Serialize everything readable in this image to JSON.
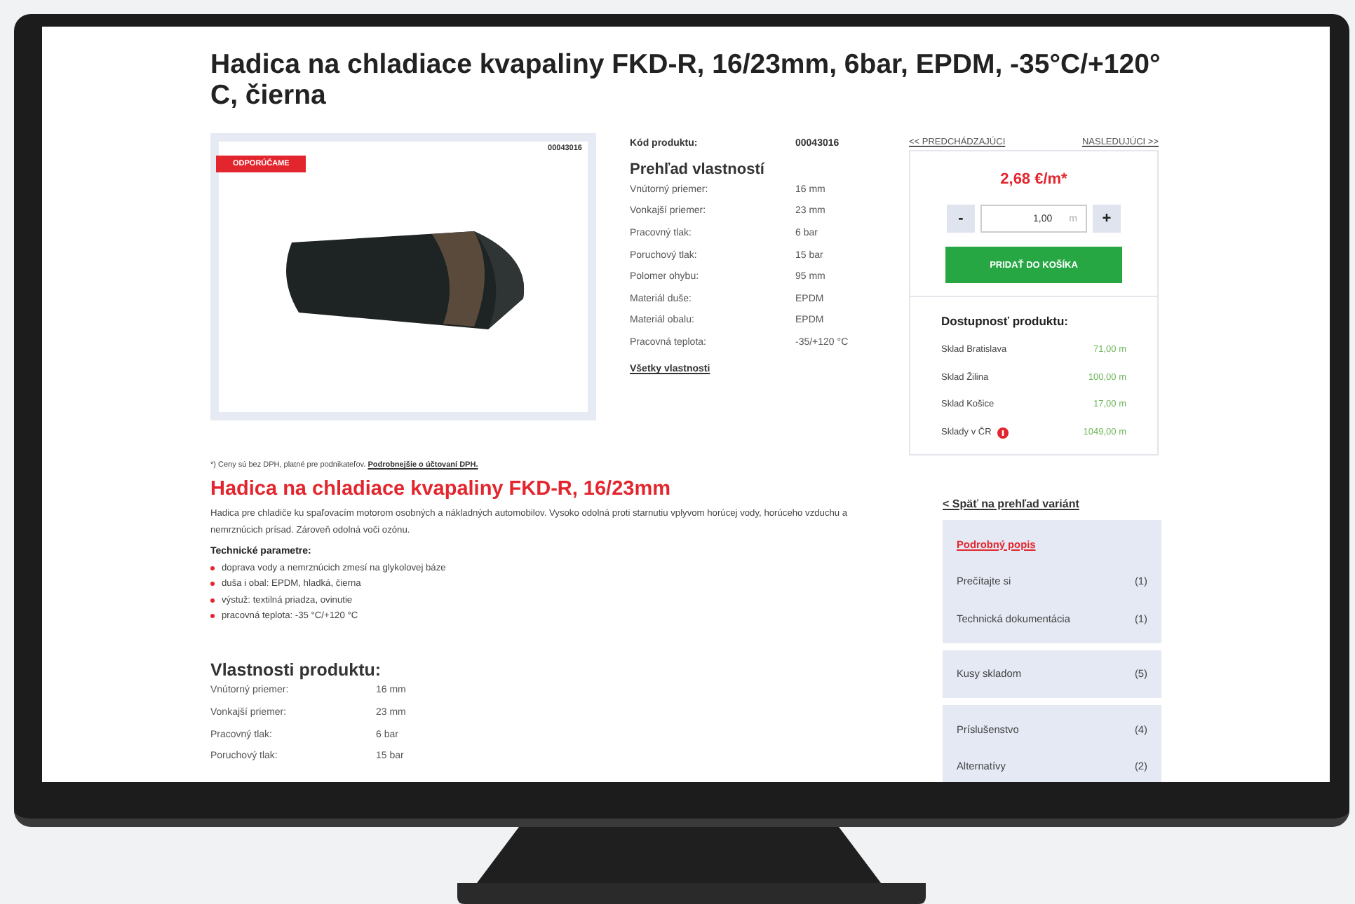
{
  "title": "Hadica na chladiace kvapaliny FKD-R, 16/23mm, 6bar, EPDM, -35°C/+120° C, čierna",
  "product_image": {
    "badge": "ODPORÚČAME",
    "code": "00043016"
  },
  "overview": {
    "code_label": "Kód produktu:",
    "code_value": "00043016",
    "heading": "Prehľad vlastností",
    "rows": [
      {
        "label": "Vnútorný priemer:",
        "value": "16 mm"
      },
      {
        "label": "Vonkajší priemer:",
        "value": "23 mm"
      },
      {
        "label": "Pracovný tlak:",
        "value": "6 bar"
      },
      {
        "label": "Poruchový tlak:",
        "value": "15 bar"
      },
      {
        "label": "Polomer ohybu:",
        "value": "95 mm"
      },
      {
        "label": "Materiál duše:",
        "value": "EPDM"
      },
      {
        "label": "Materiál obalu:",
        "value": "EPDM"
      },
      {
        "label": "Pracovná teplota:",
        "value": "-35/+120 °C"
      }
    ],
    "all_link": "Všetky vlastnosti"
  },
  "nav": {
    "prev": "<< PREDCHÁDZAJÚCI",
    "next": "NASLEDUJÚCI >>"
  },
  "purchase": {
    "price": "2,68 €/m*",
    "minus": "-",
    "quantity": "1,00",
    "unit": "m",
    "plus": "+",
    "add_button": "PRIDAŤ DO KOŠÍKA"
  },
  "availability": {
    "heading": "Dostupnosť produktu:",
    "rows": [
      {
        "name": "Sklad Bratislava",
        "amount": "71,00 m",
        "info": false
      },
      {
        "name": "Sklad Žilina",
        "amount": "100,00 m",
        "info": false
      },
      {
        "name": "Sklad Košice",
        "amount": "17,00 m",
        "info": false
      },
      {
        "name": "Sklady v ČR",
        "amount": "1049,00 m",
        "info": true
      }
    ]
  },
  "vat_note": {
    "text": "*) Ceny sú bez DPH, platné pre podnikateľov.",
    "link": "Podrobnejšie o účtovaní DPH."
  },
  "description": {
    "heading": "Hadica na chladiace kvapaliny FKD-R, 16/23mm",
    "text": "Hadica pre chladiče ku spaľovacím motorom osobných a nákladných automobilov. Vysoko odolná proti starnutiu vplyvom horúcej vody, horúceho vzduchu a nemrznúcich prísad. Zároveň odolná voči ozónu.",
    "params_heading": "Technické parametre:",
    "params": [
      "doprava vody a nemrznúcich zmesí na glykolovej báze",
      "duša i obal: EPDM, hladká, čierna",
      "výstuž: textilná priadza, ovinutie",
      "pracovná teplota: -35 °C/+120 °C"
    ]
  },
  "properties": {
    "heading": "Vlastnosti produktu:",
    "rows": [
      {
        "label": "Vnútorný priemer:",
        "value": "16 mm"
      },
      {
        "label": "Vonkajší priemer:",
        "value": "23 mm"
      },
      {
        "label": "Pracovný tlak:",
        "value": "6 bar"
      },
      {
        "label": "Poruchový tlak:",
        "value": "15 bar"
      }
    ]
  },
  "sidebar": {
    "back_link": "< Späť na prehľad variánt",
    "groups": [
      [
        {
          "label": "Podrobný popis",
          "selected": true
        },
        {
          "label": "Prečítajte si",
          "count": "(1)",
          "selected": false
        },
        {
          "label": "Technická dokumentácia",
          "count": "(1)",
          "selected": false
        }
      ],
      [
        {
          "label": "Kusy skladom",
          "count": "(5)",
          "selected": false
        }
      ],
      [
        {
          "label": "Príslušenstvo",
          "count": "(4)",
          "selected": false
        },
        {
          "label": "Alternatívy",
          "count": "(2)",
          "selected": false
        }
      ]
    ]
  }
}
